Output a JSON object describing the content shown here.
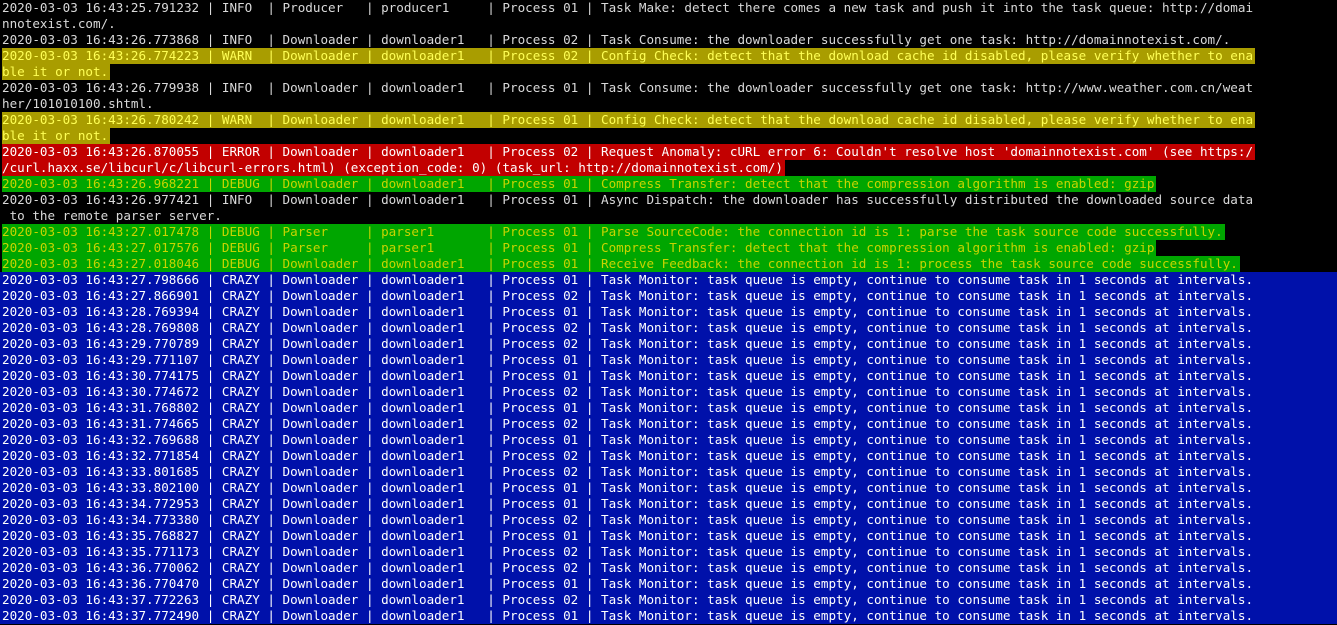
{
  "terminal": {
    "colors": {
      "info_fg": "#d9d9d9",
      "warn_bg": "#a99d00",
      "warn_fg": "#ffff55",
      "error_bg": "#c20000",
      "error_fg": "#ffffff",
      "debug_bg": "#00a600",
      "debug_fg": "#c8d400",
      "crazy_bg": "#0011aa",
      "crazy_fg": "#ffffff"
    },
    "lines": [
      {
        "level": "info",
        "text": "2020-03-03 16:43:25.791232 | INFO  | Producer   | producer1     | Process 01 | Task Make: detect there comes a new task and push it into the task queue: http://domai"
      },
      {
        "level": "info",
        "text": "nnotexist.com/."
      },
      {
        "level": "info",
        "text": "2020-03-03 16:43:26.773868 | INFO  | Downloader | downloader1   | Process 02 | Task Consume: the downloader successfully get one task: http://domainnotexist.com/."
      },
      {
        "level": "warn",
        "text": "2020-03-03 16:43:26.774223 | WARN  | Downloader | downloader1   | Process 02 | Config Check: detect that the download cache id disabled, please verify whether to ena"
      },
      {
        "level": "warn",
        "text": "ble it or not."
      },
      {
        "level": "info",
        "text": "2020-03-03 16:43:26.779938 | INFO  | Downloader | downloader1   | Process 01 | Task Consume: the downloader successfully get one task: http://www.weather.com.cn/weat"
      },
      {
        "level": "info",
        "text": "her/101010100.shtml."
      },
      {
        "level": "warn",
        "text": "2020-03-03 16:43:26.780242 | WARN  | Downloader | downloader1   | Process 01 | Config Check: detect that the download cache id disabled, please verify whether to ena"
      },
      {
        "level": "warn",
        "text": "ble it or not."
      },
      {
        "level": "error",
        "text": "2020-03-03 16:43:26.870055 | ERROR | Downloader | downloader1   | Process 02 | Request Anomaly: cURL error 6: Couldn't resolve host 'domainnotexist.com' (see https:/"
      },
      {
        "level": "error",
        "text": "/curl.haxx.se/libcurl/c/libcurl-errors.html) (exception_code: 0) (task_url: http://domainnotexist.com/)"
      },
      {
        "level": "debug",
        "text": "2020-03-03 16:43:26.968221 | DEBUG | Downloader | downloader1   | Process 01 | Compress Transfer: detect that the compression algorithm is enabled: gzip"
      },
      {
        "level": "info",
        "text": "2020-03-03 16:43:26.977421 | INFO  | Downloader | downloader1   | Process 01 | Async Dispatch: the downloader has successfully distributed the downloaded source data"
      },
      {
        "level": "info",
        "text": " to the remote parser server."
      },
      {
        "level": "debug",
        "text": "2020-03-03 16:43:27.017478 | DEBUG | Parser     | parser1       | Process 01 | Parse SourceCode: the connection id is 1: parse the task source code successfully."
      },
      {
        "level": "debug",
        "text": "2020-03-03 16:43:27.017576 | DEBUG | Parser     | parser1       | Process 01 | Compress Transfer: detect that the compression algorithm is enabled: gzip"
      },
      {
        "level": "debug",
        "text": "2020-03-03 16:43:27.018046 | DEBUG | Downloader | downloader1   | Process 01 | Receive Feedback: the connection id is 1: process the task source code successfully."
      },
      {
        "level": "crazy",
        "text": "2020-03-03 16:43:27.798666 | CRAZY | Downloader | downloader1   | Process 01 | Task Monitor: task queue is empty, continue to consume task in 1 seconds at intervals."
      },
      {
        "level": "crazy",
        "text": "2020-03-03 16:43:27.866901 | CRAZY | Downloader | downloader1   | Process 02 | Task Monitor: task queue is empty, continue to consume task in 1 seconds at intervals."
      },
      {
        "level": "crazy",
        "text": "2020-03-03 16:43:28.769394 | CRAZY | Downloader | downloader1   | Process 01 | Task Monitor: task queue is empty, continue to consume task in 1 seconds at intervals."
      },
      {
        "level": "crazy",
        "text": "2020-03-03 16:43:28.769808 | CRAZY | Downloader | downloader1   | Process 02 | Task Monitor: task queue is empty, continue to consume task in 1 seconds at intervals."
      },
      {
        "level": "crazy",
        "text": "2020-03-03 16:43:29.770789 | CRAZY | Downloader | downloader1   | Process 02 | Task Monitor: task queue is empty, continue to consume task in 1 seconds at intervals."
      },
      {
        "level": "crazy",
        "text": "2020-03-03 16:43:29.771107 | CRAZY | Downloader | downloader1   | Process 01 | Task Monitor: task queue is empty, continue to consume task in 1 seconds at intervals."
      },
      {
        "level": "crazy",
        "text": "2020-03-03 16:43:30.774175 | CRAZY | Downloader | downloader1   | Process 01 | Task Monitor: task queue is empty, continue to consume task in 1 seconds at intervals."
      },
      {
        "level": "crazy",
        "text": "2020-03-03 16:43:30.774672 | CRAZY | Downloader | downloader1   | Process 02 | Task Monitor: task queue is empty, continue to consume task in 1 seconds at intervals."
      },
      {
        "level": "crazy",
        "text": "2020-03-03 16:43:31.768802 | CRAZY | Downloader | downloader1   | Process 01 | Task Monitor: task queue is empty, continue to consume task in 1 seconds at intervals."
      },
      {
        "level": "crazy",
        "text": "2020-03-03 16:43:31.774665 | CRAZY | Downloader | downloader1   | Process 02 | Task Monitor: task queue is empty, continue to consume task in 1 seconds at intervals."
      },
      {
        "level": "crazy",
        "text": "2020-03-03 16:43:32.769688 | CRAZY | Downloader | downloader1   | Process 01 | Task Monitor: task queue is empty, continue to consume task in 1 seconds at intervals."
      },
      {
        "level": "crazy",
        "text": "2020-03-03 16:43:32.771854 | CRAZY | Downloader | downloader1   | Process 02 | Task Monitor: task queue is empty, continue to consume task in 1 seconds at intervals."
      },
      {
        "level": "crazy",
        "text": "2020-03-03 16:43:33.801685 | CRAZY | Downloader | downloader1   | Process 02 | Task Monitor: task queue is empty, continue to consume task in 1 seconds at intervals."
      },
      {
        "level": "crazy",
        "text": "2020-03-03 16:43:33.802100 | CRAZY | Downloader | downloader1   | Process 01 | Task Monitor: task queue is empty, continue to consume task in 1 seconds at intervals."
      },
      {
        "level": "crazy",
        "text": "2020-03-03 16:43:34.772953 | CRAZY | Downloader | downloader1   | Process 01 | Task Monitor: task queue is empty, continue to consume task in 1 seconds at intervals."
      },
      {
        "level": "crazy",
        "text": "2020-03-03 16:43:34.773380 | CRAZY | Downloader | downloader1   | Process 02 | Task Monitor: task queue is empty, continue to consume task in 1 seconds at intervals."
      },
      {
        "level": "crazy",
        "text": "2020-03-03 16:43:35.768827 | CRAZY | Downloader | downloader1   | Process 01 | Task Monitor: task queue is empty, continue to consume task in 1 seconds at intervals."
      },
      {
        "level": "crazy",
        "text": "2020-03-03 16:43:35.771173 | CRAZY | Downloader | downloader1   | Process 02 | Task Monitor: task queue is empty, continue to consume task in 1 seconds at intervals."
      },
      {
        "level": "crazy",
        "text": "2020-03-03 16:43:36.770062 | CRAZY | Downloader | downloader1   | Process 02 | Task Monitor: task queue is empty, continue to consume task in 1 seconds at intervals."
      },
      {
        "level": "crazy",
        "text": "2020-03-03 16:43:36.770470 | CRAZY | Downloader | downloader1   | Process 01 | Task Monitor: task queue is empty, continue to consume task in 1 seconds at intervals."
      },
      {
        "level": "crazy",
        "text": "2020-03-03 16:43:37.772263 | CRAZY | Downloader | downloader1   | Process 02 | Task Monitor: task queue is empty, continue to consume task in 1 seconds at intervals."
      },
      {
        "level": "crazy",
        "text": "2020-03-03 16:43:37.772490 | CRAZY | Downloader | downloader1   | Process 01 | Task Monitor: task queue is empty, continue to consume task in 1 seconds at intervals."
      }
    ]
  }
}
